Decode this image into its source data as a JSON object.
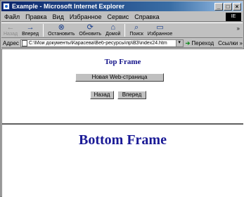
{
  "window": {
    "title": "Example - Microsoft Internet Explorer",
    "controls": {
      "minimize": "_",
      "maximize": "□",
      "close": "×"
    }
  },
  "menu": {
    "items": [
      "Файл",
      "Правка",
      "Вид",
      "Избранное",
      "Сервис",
      "Справка"
    ],
    "throbber_label": "IE"
  },
  "toolbar": {
    "buttons": [
      {
        "label": "Назад",
        "icon": "back-arrow-icon",
        "glyph": "←"
      },
      {
        "label": "Вперед",
        "icon": "forward-arrow-icon",
        "glyph": "→"
      },
      {
        "label": "Остановить",
        "icon": "stop-icon",
        "glyph": "⊗"
      },
      {
        "label": "Обновить",
        "icon": "refresh-icon",
        "glyph": "⟳"
      },
      {
        "label": "Домой",
        "icon": "home-icon",
        "glyph": "⌂"
      },
      {
        "label": "Поиск",
        "icon": "search-icon",
        "glyph": "⌕"
      },
      {
        "label": "Избранное",
        "icon": "favorites-icon",
        "glyph": "▭"
      }
    ],
    "more": "»"
  },
  "address": {
    "label": "Адрес",
    "value": "C:\\Мои документы\\Карасева\\Веб-ресурсы\\пр\\ВЗ\\index24.htm",
    "dropdown": "▾",
    "go_label": "Переход",
    "go_glyph": "➔",
    "links_label": "Ссылки »"
  },
  "page": {
    "top_frame_title": "Top Frame",
    "new_page_button": "Новая Web-страница",
    "back_button": "Назад",
    "forward_button": "Вперед",
    "bottom_frame_title": "Bottom Frame"
  },
  "colors": {
    "title_bar": "#0a246a",
    "frame_heading": "#14148a",
    "chrome": "#c0c0c0"
  }
}
